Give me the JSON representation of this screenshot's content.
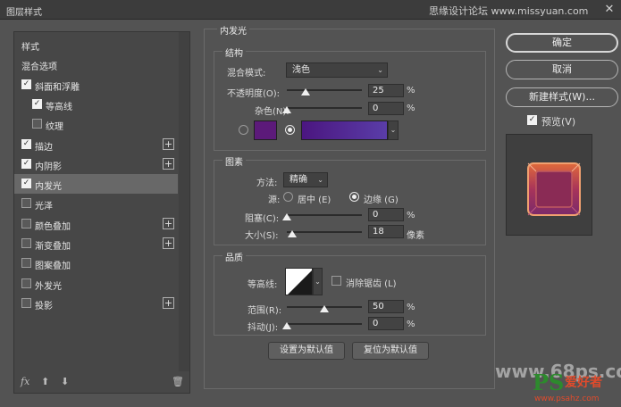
{
  "window": {
    "title": "图层样式",
    "site": "思缘设计论坛 www.missyuan.com",
    "close": "✕"
  },
  "left_panel": {
    "items": [
      {
        "label": "样式",
        "checkbox": false,
        "checked": false,
        "plus": false,
        "active": false
      },
      {
        "label": "混合选项",
        "checkbox": false,
        "checked": false,
        "plus": false,
        "active": false
      },
      {
        "label": "斜面和浮雕",
        "checkbox": true,
        "checked": true,
        "plus": false,
        "active": false
      },
      {
        "label": "等高线",
        "checkbox": true,
        "checked": true,
        "plus": false,
        "active": false,
        "indent": true
      },
      {
        "label": "纹理",
        "checkbox": true,
        "checked": false,
        "plus": false,
        "active": false,
        "indent": true
      },
      {
        "label": "描边",
        "checkbox": true,
        "checked": true,
        "plus": true,
        "active": false
      },
      {
        "label": "内阴影",
        "checkbox": true,
        "checked": true,
        "plus": true,
        "active": false
      },
      {
        "label": "内发光",
        "checkbox": true,
        "checked": true,
        "plus": false,
        "active": true
      },
      {
        "label": "光泽",
        "checkbox": true,
        "checked": false,
        "plus": false,
        "active": false
      },
      {
        "label": "颜色叠加",
        "checkbox": true,
        "checked": false,
        "plus": true,
        "active": false
      },
      {
        "label": "渐变叠加",
        "checkbox": true,
        "checked": false,
        "plus": true,
        "active": false
      },
      {
        "label": "图案叠加",
        "checkbox": true,
        "checked": false,
        "plus": false,
        "active": false
      },
      {
        "label": "外发光",
        "checkbox": true,
        "checked": false,
        "plus": false,
        "active": false
      },
      {
        "label": "投影",
        "checkbox": true,
        "checked": false,
        "plus": true,
        "active": false
      }
    ],
    "footer": {
      "fx": "fx",
      "up": "⬆",
      "down": "⬇",
      "trash": "🗑"
    }
  },
  "main": {
    "section_title": "内发光",
    "structure": {
      "title": "结构",
      "blend_mode_label": "混合模式:",
      "blend_mode_value": "浅色",
      "opacity_label": "不透明度(O):",
      "opacity_value": "25",
      "opacity_fraction": 0.25,
      "noise_label": "杂色(N):",
      "noise_value": "0",
      "noise_fraction": 0,
      "unit": "%",
      "color": "#5c1a7a"
    },
    "elements": {
      "title": "图素",
      "method_label": "方法:",
      "method_value": "精确",
      "source_label": "源:",
      "source_center": "居中 (E)",
      "source_edge": "边缘 (G)",
      "choke_label": "阻塞(C):",
      "choke_value": "0",
      "choke_fraction": 0,
      "size_label": "大小(S):",
      "size_value": "18",
      "size_fraction": 0.07,
      "unit_pct": "%",
      "unit_px": "像素"
    },
    "quality": {
      "title": "品质",
      "contour_label": "等高线:",
      "antialias_label": "消除锯齿 (L)",
      "range_label": "范围(R):",
      "range_value": "50",
      "range_fraction": 0.5,
      "jitter_label": "抖动(J):",
      "jitter_value": "0",
      "jitter_fraction": 0,
      "unit": "%"
    },
    "buttons": {
      "make_default": "设置为默认值",
      "reset_default": "复位为默认值"
    }
  },
  "right": {
    "ok": "确定",
    "cancel": "取消",
    "new_style": "新建样式(W)...",
    "preview_label": "预览(V)",
    "preview_checked": true
  },
  "watermarks": {
    "site": "www.68ps.com",
    "ps": "PS",
    "ps_cn": "爱好者",
    "ps_url": "www.psahz.com"
  }
}
